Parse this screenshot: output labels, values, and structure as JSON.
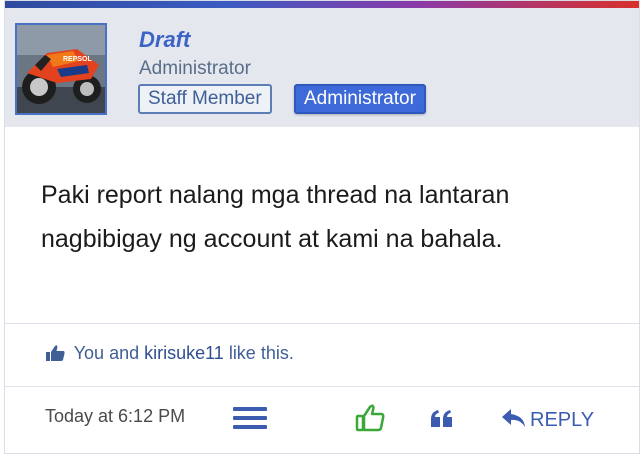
{
  "post": {
    "username": "Draft",
    "user_title": "Administrator",
    "badges": [
      "Staff Member",
      "Administrator"
    ],
    "message_line1": "Paki report nalang mga thread na lantaran",
    "message_line2": "nagbibigay ng account at kami na bahala.",
    "likes": {
      "prefix": "You and ",
      "user": "kirisuke11",
      "suffix": " like this."
    },
    "date": "Today at 6:12 PM",
    "reply_label": "REPLY"
  },
  "colors": {
    "accent": "#3d6ad8",
    "link": "#3f5f97",
    "like_green": "#3aa836"
  },
  "icons": [
    "thumbs-up-icon",
    "hamburger-menu-icon",
    "like-thumb-icon",
    "quote-icon",
    "reply-arrow-icon"
  ]
}
